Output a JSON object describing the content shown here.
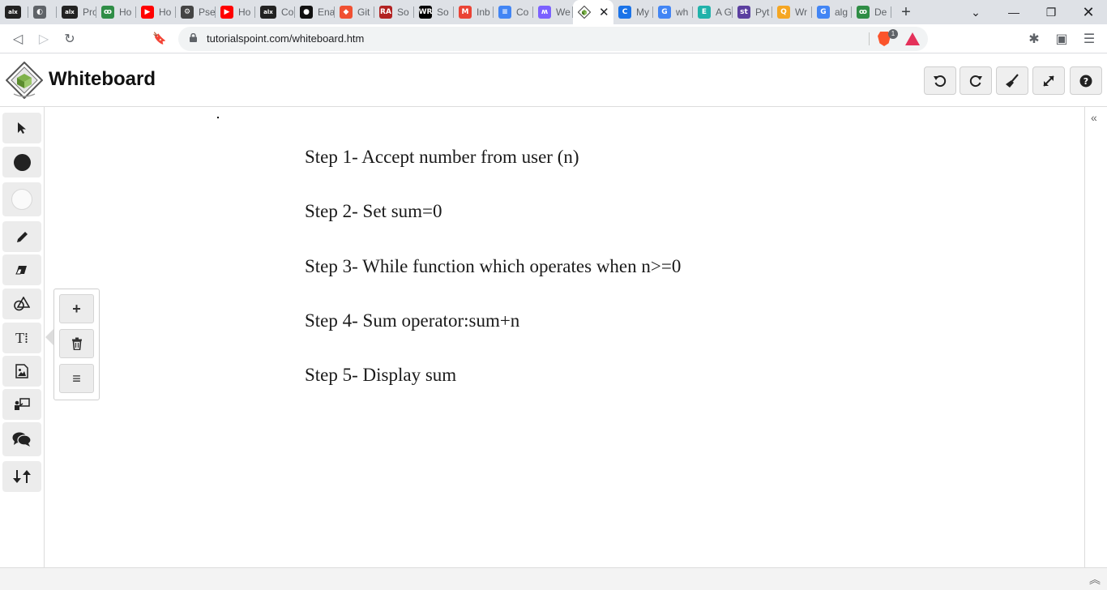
{
  "browser": {
    "tabs": [
      {
        "title": "",
        "favicon": "alx-icon",
        "color": "#222222",
        "glyph": "alx"
      },
      {
        "title": "",
        "favicon": "globe-icon",
        "color": "#5f6368",
        "glyph": "◐"
      },
      {
        "title": "Pro",
        "favicon": "alx-icon",
        "color": "#222222",
        "glyph": "alx"
      },
      {
        "title": "Ho",
        "favicon": "gfg-icon",
        "color": "#2f8d46",
        "glyph": "ꝏ"
      },
      {
        "title": "Ho",
        "favicon": "youtube-icon",
        "color": "#ff0000",
        "glyph": "▶"
      },
      {
        "title": "Pse",
        "favicon": "chip-icon",
        "color": "#444444",
        "glyph": "⚙"
      },
      {
        "title": "Ho",
        "favicon": "youtube-icon",
        "color": "#ff0000",
        "glyph": "▶"
      },
      {
        "title": "Cor",
        "favicon": "alx-icon",
        "color": "#222222",
        "glyph": "alx"
      },
      {
        "title": "Ena",
        "favicon": "github-icon",
        "color": "#111111",
        "glyph": "●"
      },
      {
        "title": "Git",
        "favicon": "git-icon",
        "color": "#f05032",
        "glyph": "◆"
      },
      {
        "title": "So",
        "favicon": "ra-icon",
        "color": "#b22222",
        "glyph": "RA"
      },
      {
        "title": "So",
        "favicon": "wr-icon",
        "color": "#000000",
        "glyph": "WR"
      },
      {
        "title": "Inb",
        "favicon": "gmail-icon",
        "color": "#ea4335",
        "glyph": "M"
      },
      {
        "title": "Co",
        "favicon": "docs-icon",
        "color": "#4285f4",
        "glyph": "≡"
      },
      {
        "title": "We",
        "favicon": "w-icon",
        "color": "#7b61ff",
        "glyph": "ʍ"
      }
    ],
    "active_tab": {
      "title": "",
      "favicon": "tutorialspoint-icon",
      "close": "✕"
    },
    "tabs_after": [
      {
        "title": "My",
        "favicon": "c-icon",
        "color": "#1a73e8",
        "glyph": "C"
      },
      {
        "title": "wh",
        "favicon": "google-icon",
        "color": "#4285f4",
        "glyph": "G"
      },
      {
        "title": "A G",
        "favicon": "e-icon",
        "color": "#20b2aa",
        "glyph": "E"
      },
      {
        "title": "Pyt",
        "favicon": "st-icon",
        "color": "#5b3fa0",
        "glyph": "st"
      },
      {
        "title": "Wr",
        "favicon": "q-icon",
        "color": "#f5a623",
        "glyph": "Q"
      },
      {
        "title": "alg",
        "favicon": "google-icon",
        "color": "#4285f4",
        "glyph": "G"
      },
      {
        "title": "De",
        "favicon": "gfg-icon",
        "color": "#2f8d46",
        "glyph": "ꝏ"
      }
    ],
    "new_tab": "+",
    "url": "tutorialspoint.com/whiteboard.htm",
    "brave_badge": "1"
  },
  "app": {
    "title": "Whiteboard"
  },
  "canvas": {
    "steps": [
      "Step 1- Accept number from user (n)",
      "Step 2- Set sum=0",
      "Step 3- While function which operates when n>=0",
      "Step 4- Sum operator:sum+n",
      "Step 5- Display sum"
    ]
  },
  "popover": {
    "add": "+",
    "delete": "🗑",
    "menu": "≡"
  }
}
